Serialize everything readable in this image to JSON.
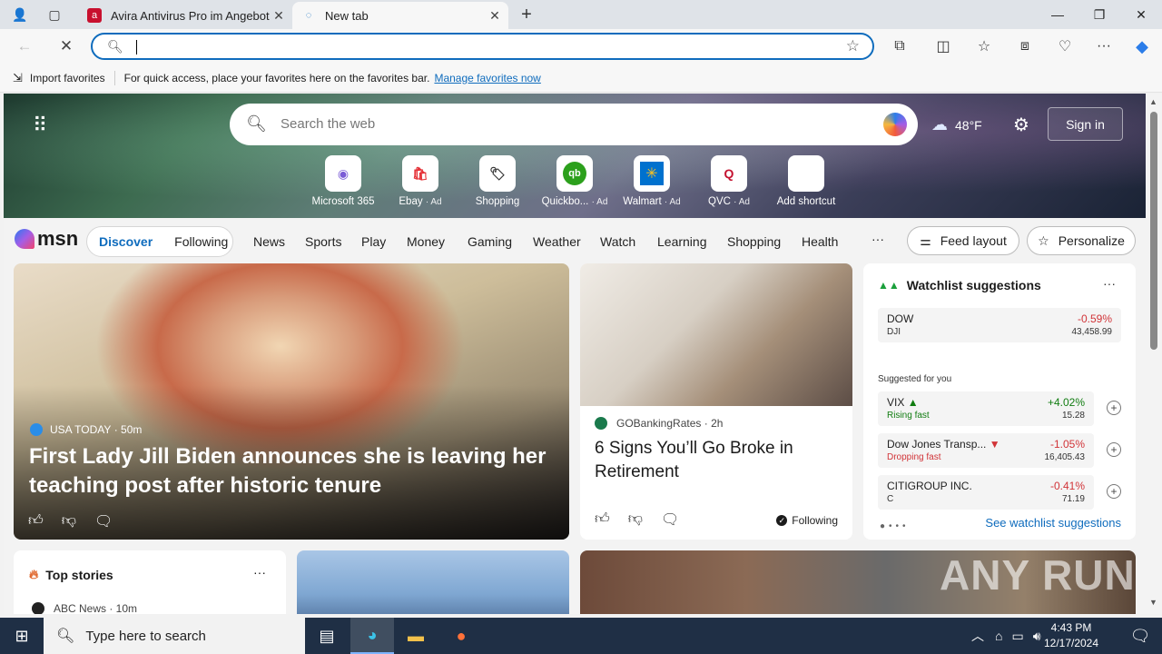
{
  "browser": {
    "tabs": [
      {
        "label": "Avira Antivirus Pro im Angebot",
        "active": false
      },
      {
        "label": "New tab",
        "active": true
      }
    ],
    "address": {
      "value": ""
    },
    "favorites_bar": {
      "import_label": "Import favorites",
      "message": "For quick access, place your favorites here on the favorites bar.",
      "manage_link": "Manage favorites now"
    }
  },
  "newtab": {
    "search_placeholder": "Search the web",
    "weather": {
      "temp": "48°F",
      "icon": "cloud-icon"
    },
    "signin_label": "Sign in",
    "shortcuts": [
      {
        "label": "Microsoft 365",
        "ad": ""
      },
      {
        "label": "Ebay",
        "ad": "· Ad"
      },
      {
        "label": "Shopping",
        "ad": ""
      },
      {
        "label": "Quickbo...",
        "ad": "· Ad"
      },
      {
        "label": "Walmart",
        "ad": "· Ad"
      },
      {
        "label": "QVC",
        "ad": "· Ad"
      },
      {
        "label": "Add shortcut",
        "ad": ""
      }
    ],
    "nav": {
      "logo": "msn",
      "discover": "Discover",
      "following": "Following",
      "items": [
        "News",
        "Sports",
        "Play",
        "Money",
        "Gaming",
        "Weather",
        "Watch",
        "Learning",
        "Shopping",
        "Health"
      ],
      "more": "···",
      "feed_layout": "Feed layout",
      "personalize": "Personalize"
    },
    "hero_story": {
      "source": "USA TODAY",
      "time": "· 50m",
      "title": "First Lady Jill Biden announces she is leaving her teaching post after historic tenure"
    },
    "story2": {
      "source": "GOBankingRates",
      "time": "· 2h",
      "title": "6 Signs You’ll Go Broke in Retirement",
      "following": "Following"
    },
    "watchlist": {
      "title": "Watchlist suggestions",
      "pinned": {
        "name": "DOW",
        "sub": "DJI",
        "pct": "-0.59%",
        "price": "43,458.99"
      },
      "suggested_label": "Suggested for you",
      "suggested": [
        {
          "name": "VIX",
          "sub": "Rising fast",
          "pct": "+4.02%",
          "price": "15.28",
          "trend": "pos"
        },
        {
          "name": "Dow Jones Transp...",
          "sub": "Dropping fast",
          "pct": "-1.05%",
          "price": "16,405.43",
          "trend": "neg"
        },
        {
          "name": "CITIGROUP INC.",
          "sub": "C",
          "pct": "-0.41%",
          "price": "71.19",
          "trend": "neg"
        }
      ],
      "see_all": "See watchlist suggestions"
    },
    "top_stories": {
      "title": "Top stories",
      "first_source": "ABC News · 10m"
    },
    "watermark": "ANY RUN"
  },
  "taskbar": {
    "search_placeholder": "Type here to search",
    "time": "4:43 PM",
    "date": "12/17/2024"
  }
}
